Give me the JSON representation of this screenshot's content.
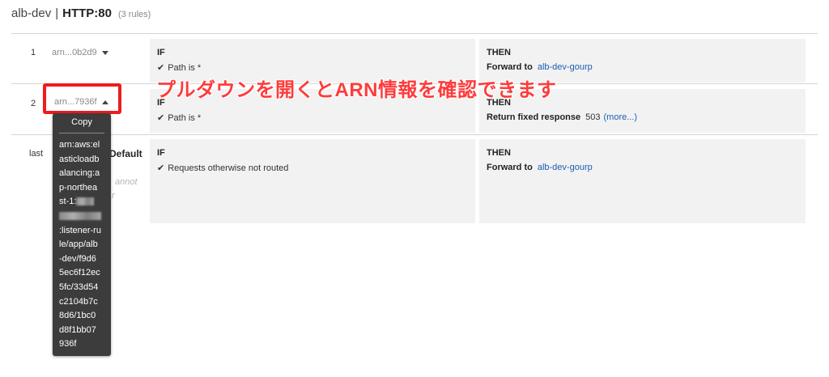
{
  "header": {
    "lb_name": "alb-dev",
    "separator": "|",
    "listener": "HTTP:80",
    "rule_count": "(3 rules)"
  },
  "rules": [
    {
      "number": "1",
      "arn_short": "arn...0b2d9",
      "if_title": "IF",
      "condition": "Path is *",
      "then_title": "THEN",
      "action_label": "Forward to",
      "action_target": "alb-dev-gourp"
    },
    {
      "number": "2",
      "arn_short": "arn...7936f",
      "if_title": "IF",
      "condition": "Path is *",
      "then_title": "THEN",
      "action_label": "Return fixed response",
      "action_value": "503",
      "more_link": "(more...)"
    },
    {
      "number": "last",
      "name": "Default",
      "note_line1": "annot",
      "note_line2": "r",
      "if_title": "IF",
      "condition": "Requests otherwise not routed",
      "then_title": "THEN",
      "action_label": "Forward to",
      "action_target": "alb-dev-gourp"
    }
  ],
  "dropdown": {
    "copy_label": "Copy",
    "arn_lines": [
      "arn:aws:el",
      "asticloadb",
      "alancing:a",
      "p-northea",
      "st-1:",
      "",
      ":listener-ru",
      "le/app/alb",
      "-dev/f9d6",
      "5ec6f12ec",
      "5fc/33d54",
      "c2104b7c",
      "8d6/1bc0",
      "d8f1bb07",
      "936f"
    ]
  },
  "annotation": "プルダウンを開くとARN情報を確認できます",
  "colors": {
    "accent_red": "#ee1c1c",
    "link_blue": "#1a5fb4",
    "panel_bg": "#f2f2f2",
    "dropdown_bg": "#3c3c3c"
  },
  "icons": {
    "checkmark": "check-icon",
    "dropdown_closed": "caret-down-icon",
    "dropdown_open": "caret-up-icon"
  }
}
